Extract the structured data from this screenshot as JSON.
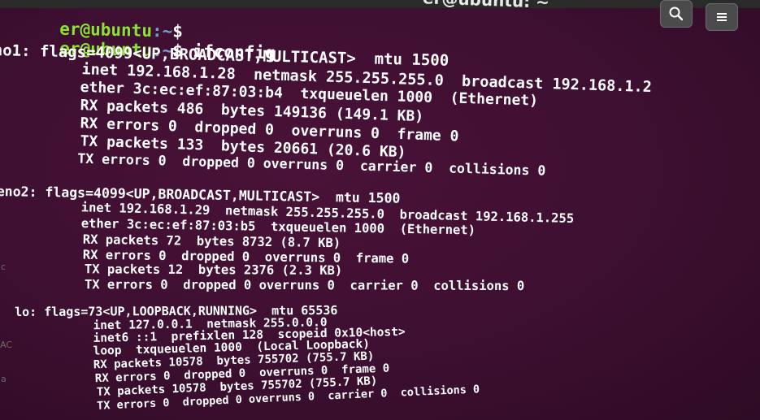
{
  "window": {
    "title": "er@ubuntu: ~"
  },
  "toolbar": {
    "search_icon": "search-icon",
    "menu_icon": "hamburger-menu-icon"
  },
  "prompts": [
    {
      "user": "er@ubuntu",
      "path": ":~",
      "symbol": "$",
      "command": ""
    },
    {
      "user": "er@ubuntu",
      "path": ":~",
      "symbol": "$",
      "command": " ifconfig"
    }
  ],
  "output": [
    "no1: flags=4099<UP,BROADCAST,MULTICAST>  mtu 1500",
    "      inet 192.168.1.28  netmask 255.255.255.0  broadcast 192.168.1.2",
    "      ether 3c:ec:ef:87:03:b4  txqueuelen 1000  (Ethernet)",
    "      RX packets 486  bytes 149136 (149.1 KB)",
    "      RX errors 0  dropped 0  overruns 0  frame 0",
    "      TX packets 133  bytes 20661 (20.6 KB)",
    "      TX errors 0  dropped 0 overruns 0  carrier 0  collisions 0",
    "eno2: flags=4099<UP,BROADCAST,MULTICAST>  mtu 1500",
    "      inet 192.168.1.29  netmask 255.255.255.0  broadcast 192.168.1.255",
    "      ether 3c:ec:ef:87:03:b5  txqueuelen 1000  (Ethernet)",
    "      RX packets 72  bytes 8732 (8.7 KB)",
    "      RX errors 0  dropped 0  overruns 0  frame 0",
    "      TX packets 12  bytes 2376 (2.3 KB)",
    "      TX errors 0  dropped 0 overruns 0  carrier 0  collisions 0",
    "lo: flags=73<UP,LOOPBACK,RUNNING>  mtu 65536",
    "      inet 127.0.0.1  netmask 255.0.0.0",
    "      inet6 ::1  prefixlen 128  scopeid 0x10<host>",
    "      loop  txqueuelen 1000  (Local Loopback)",
    "      RX packets 10578  bytes 755702 (755.7 KB)",
    "      RX errors 0  dropped 0  overruns 0  frame 0",
    "      TX packets 10578  bytes 755702 (755.7 KB)",
    "      TX errors 0  dropped 0 overruns 0  carrier 0  collisions 0"
  ],
  "edge_marks": [
    "c",
    "AC",
    "a"
  ],
  "colors": {
    "background": "#3d0f30",
    "user": "#8ae234",
    "path": "#729fcf",
    "text": "#ffffff"
  }
}
